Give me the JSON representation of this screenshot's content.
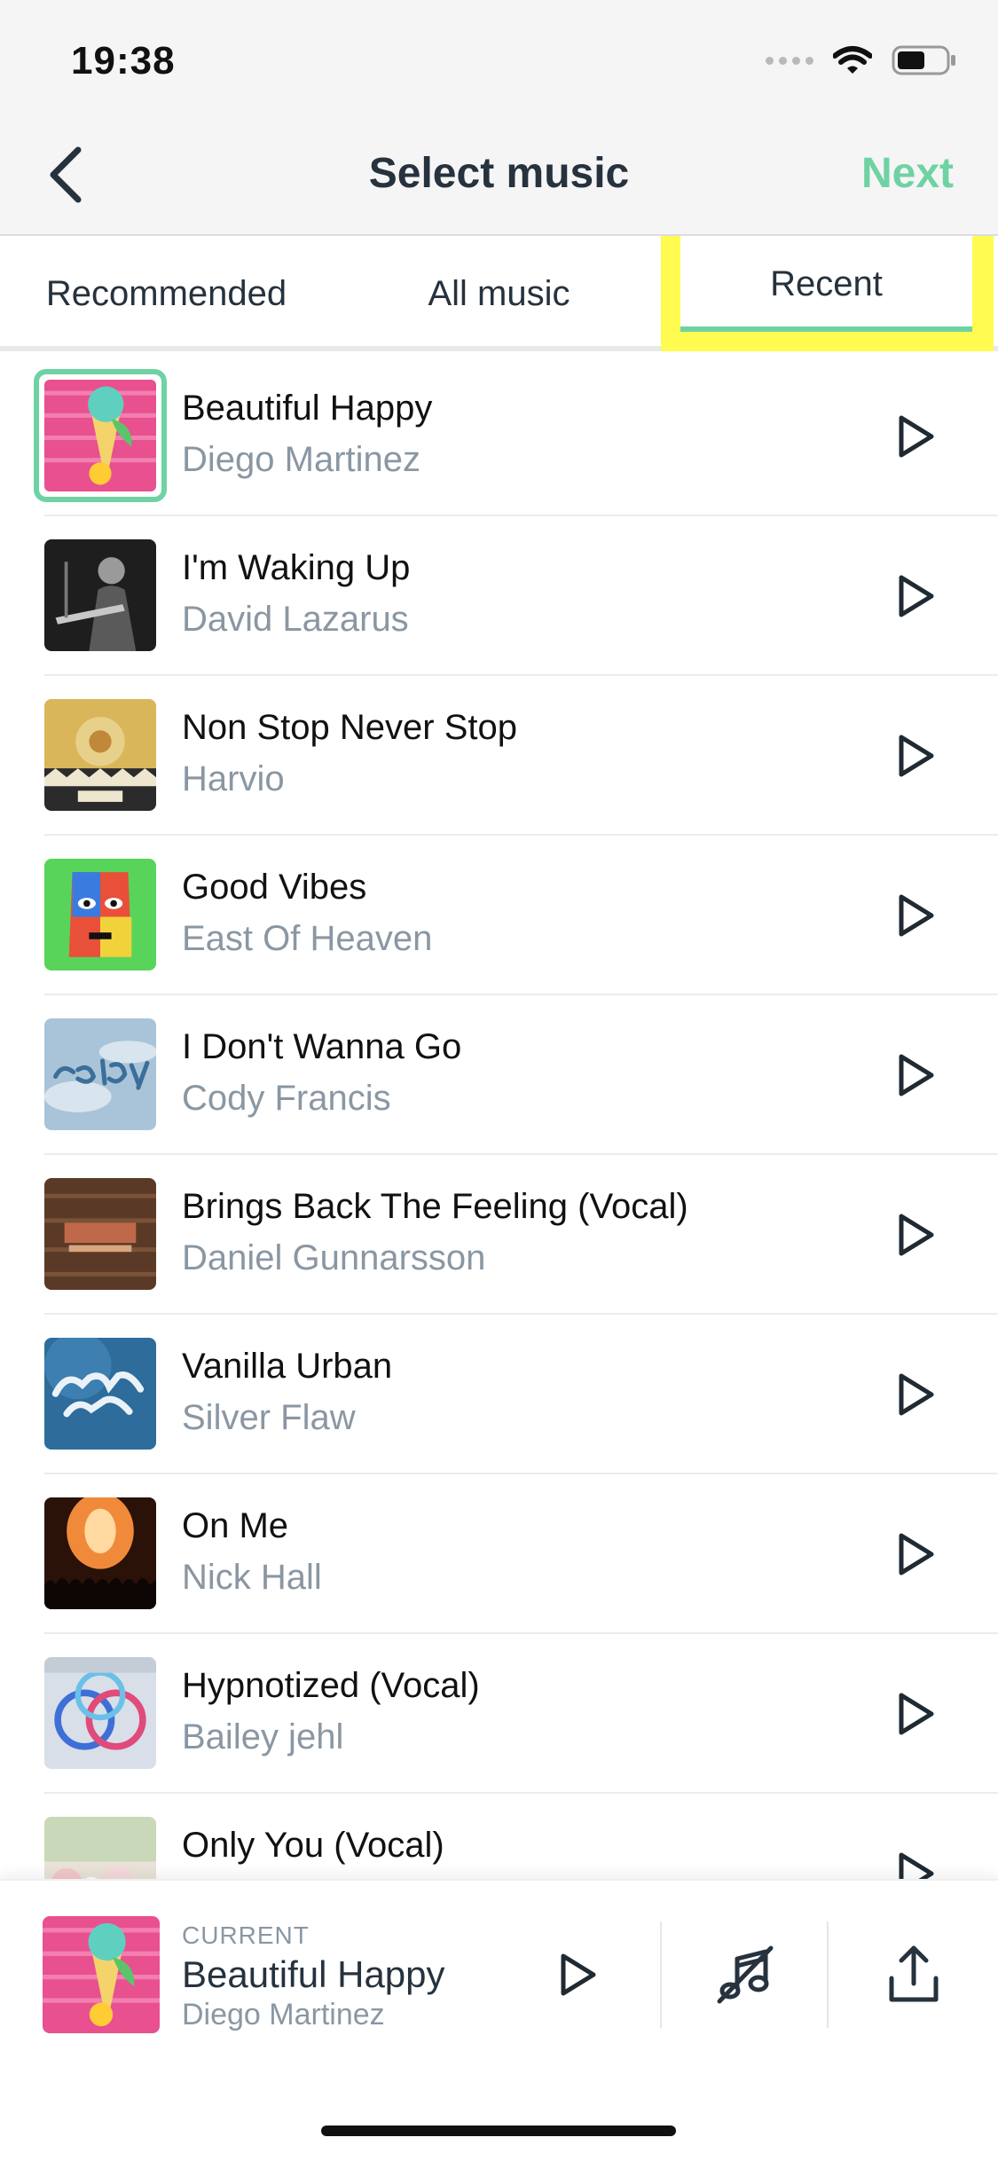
{
  "status_bar": {
    "time": "19:38"
  },
  "header": {
    "title": "Select music",
    "next_label": "Next"
  },
  "tabs": [
    {
      "label": "Recommended",
      "selected": false
    },
    {
      "label": "All music",
      "selected": false
    },
    {
      "label": "Recent",
      "selected": true
    }
  ],
  "accent_color": "#6fd2a3",
  "highlight_color": "#fffb50",
  "songs": [
    {
      "title": "Beautiful Happy",
      "artist": "Diego Martinez",
      "selected": true
    },
    {
      "title": "I'm Waking Up",
      "artist": "David Lazarus"
    },
    {
      "title": "Non Stop Never Stop",
      "artist": "Harvio"
    },
    {
      "title": "Good Vibes",
      "artist": "East Of Heaven"
    },
    {
      "title": "I Don't Wanna Go",
      "artist": "Cody Francis"
    },
    {
      "title": "Brings Back The Feeling (Vocal)",
      "artist": "Daniel Gunnarsson"
    },
    {
      "title": "Vanilla Urban",
      "artist": "Silver Flaw"
    },
    {
      "title": "On Me",
      "artist": "Nick Hall"
    },
    {
      "title": "Hypnotized (Vocal)",
      "artist": "Bailey jehl"
    },
    {
      "title": "Only You (Vocal)",
      "artist": ""
    }
  ],
  "player": {
    "current_label": "CURRENT",
    "title": "Beautiful Happy",
    "artist": "Diego Martinez"
  },
  "icons": [
    "back-chevron-icon",
    "wifi-icon",
    "battery-icon",
    "play-icon",
    "music-off-icon",
    "share-icon"
  ]
}
